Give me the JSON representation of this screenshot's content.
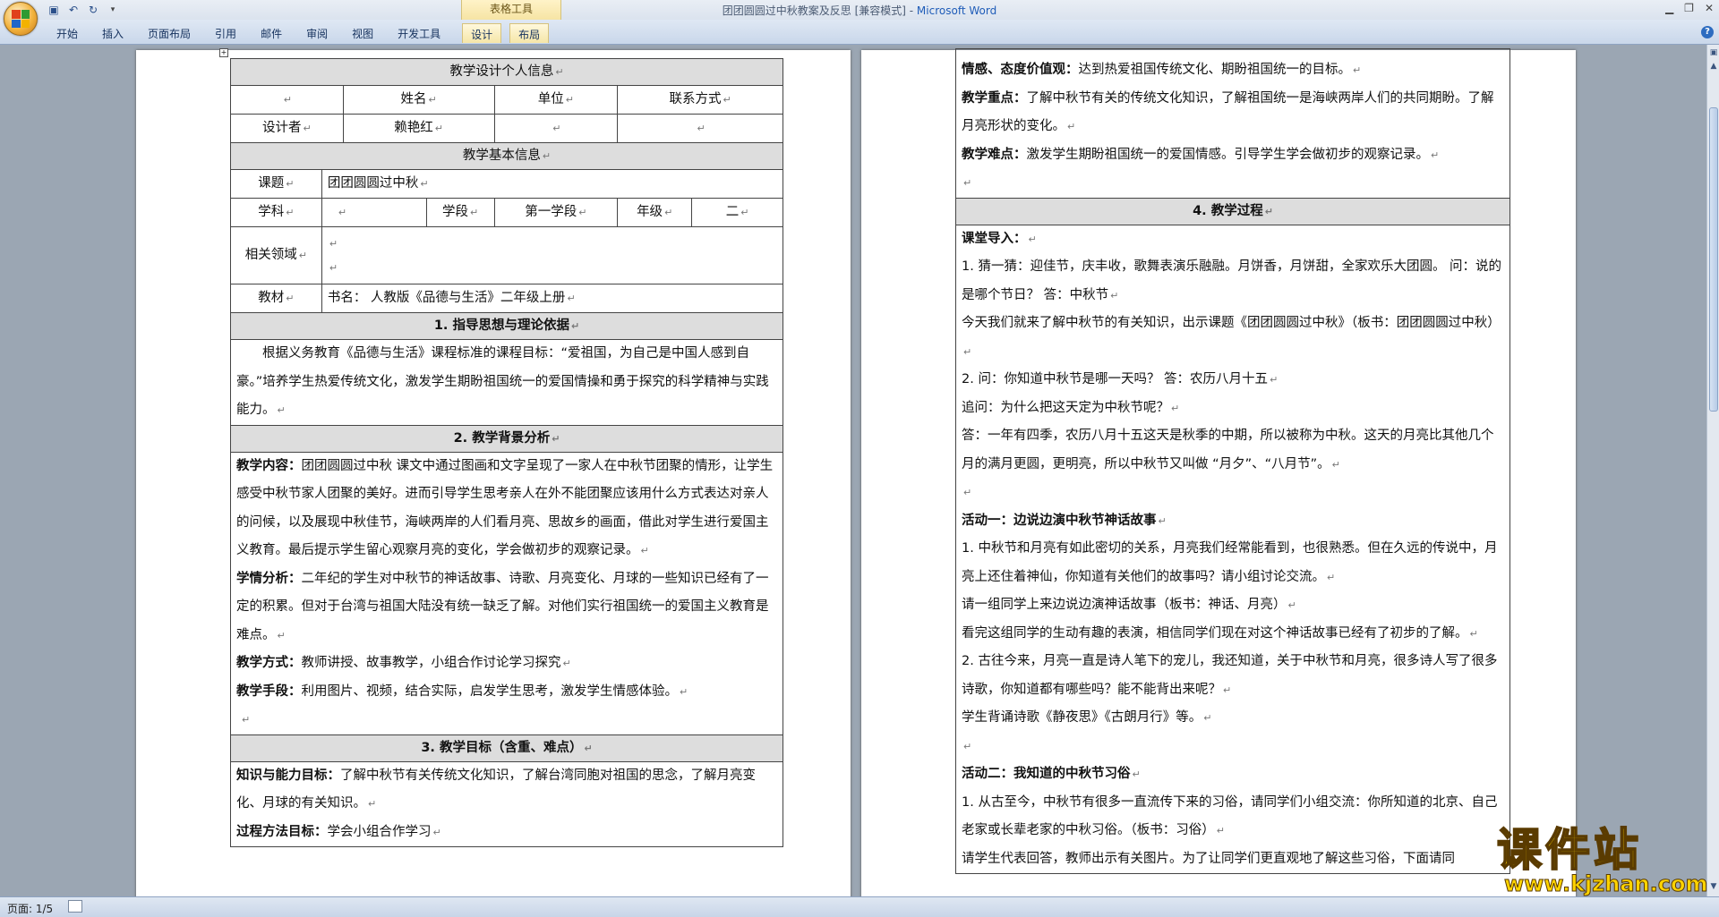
{
  "window": {
    "title": "团团圆圆过中秋教案及反思 [兼容模式] - ",
    "app_name": "Microsoft Word",
    "context_tab_group": "表格工具"
  },
  "ribbon": {
    "tabs": [
      "开始",
      "插入",
      "页面布局",
      "引用",
      "邮件",
      "审阅",
      "视图",
      "开发工具",
      "设计",
      "布局"
    ]
  },
  "left_page": {
    "personal_info_header": "教学设计个人信息",
    "col_name": "姓名",
    "col_unit": "单位",
    "col_contact": "联系方式",
    "designer_label": "设计者",
    "designer_name": "赖艳红",
    "basic_info_header": "教学基本信息",
    "topic_label": "课题",
    "topic_value": "团团圆圆过中秋",
    "subject_label": "学科",
    "stage_label": "学段",
    "stage_value": "第一学段",
    "grade_label": "年级",
    "grade_value": "二",
    "field_label": "相关领域",
    "textbook_label": "教材",
    "textbook_value": "书名：   人教版《品德与生活》二年级上册",
    "sec1": "1. 指导思想与理论依据",
    "sec1_text": "根据义务教育《品德与生活》课程标准的课程目标：“爱祖国，为自己是中国人感到自豪。”培养学生热爱传统文化，激发学生期盼祖国统一的爱国情操和勇于探究的科学精神与实践能力。",
    "sec2": "2. 教学背景分析",
    "content_label": "教学内容：",
    "content_text": "团团圆圆过中秋 课文中通过图画和文字呈现了一家人在中秋节团聚的情形，让学生感受中秋节家人团聚的美好。进而引导学生思考亲人在外不能团聚应该用什么方式表达对亲人的问候，以及展现中秋佳节，海峡两岸的人们看月亮、思故乡的画面，借此对学生进行爱国主义教育。最后提示学生留心观察月亮的变化，学会做初步的观察记录。",
    "learner_label": "学情分析：",
    "learner_text": "二年纪的学生对中秋节的神话故事、诗歌、月亮变化、月球的一些知识已经有了一定的积累。但对于台湾与祖国大陆没有统一缺乏了解。对他们实行祖国统一的爱国主义教育是难点。",
    "method_label": "教学方式：",
    "method_text": "教师讲授、故事教学，小组合作讨论学习探究",
    "means_label": "教学手段：",
    "means_text": "利用图片、视频，结合实际，启发学生思考，激发学生情感体验。",
    "sec3": "3. 教学目标（含重、难点）",
    "knowledge_label": "知识与能力目标：",
    "knowledge_text": "了解中秋节有关传统文化知识，了解台湾同胞对祖国的思念，了解月亮变化、月球的有关知识。",
    "process_label": "过程方法目标：",
    "process_text": "学会小组合作学习"
  },
  "right_page": {
    "emotion_label": "情感、态度价值观：",
    "emotion_text": "达到热爱祖国传统文化、期盼祖国统一的目标。",
    "key_label": "教学重点：",
    "key_text": "了解中秋节有关的传统文化知识，了解祖国统一是海峡两岸人们的共同期盼。了解月亮形状的变化。",
    "difficult_label": "教学难点：",
    "difficult_text": "激发学生期盼祖国统一的爱国情感。引导学生学会做初步的观察记录。",
    "sec4": "4. 教学过程",
    "intro_label": "课堂导入：",
    "p1": "1. 猜一猜：迎佳节，庆丰收，歌舞表演乐融融。月饼香，月饼甜，全家欢乐大团圆。  问：说的是哪个节日？  答：中秋节",
    "p2": "今天我们就来了解中秋节的有关知识，出示课题《团团圆圆过中秋》（板书：团团圆圆过中秋）",
    "p3": "2. 问：你知道中秋节是哪一天吗？    答：农历八月十五",
    "p4": "追问：为什么把这天定为中秋节呢？",
    "p5": "答：一年有四季，农历八月十五这天是秋季的中期，所以被称为中秋。这天的月亮比其他几个月的满月更圆，更明亮，所以中秋节又叫做 “月夕”、“八月节”。",
    "act1_label": "活动一：边说边演中秋节神话故事",
    "a1": "1. 中秋节和月亮有如此密切的关系，月亮我们经常能看到，也很熟悉。但在久远的传说中，月亮上还住着神仙，你知道有关他们的故事吗？请小组讨论交流。",
    "a2": "请一组同学上来边说边演神话故事（板书：神话、月亮）",
    "a3": "看完这组同学的生动有趣的表演，相信同学们现在对这个神话故事已经有了初步的了解。",
    "a4": "2. 古往今来，月亮一直是诗人笔下的宠儿，我还知道，关于中秋节和月亮，很多诗人写了很多诗歌，你知道都有哪些吗？能不能背出来呢？",
    "a5": "学生背诵诗歌《静夜思》《古朗月行》等。",
    "act2_label": "活动二：我知道的中秋节习俗",
    "b1": "1. 从古至今，中秋节有很多一直流传下来的习俗，请同学们小组交流：你所知道的北京、自己老家或长辈老家的中秋习俗。（板书：习俗）",
    "b2": "请学生代表回答，教师出示有关图片。为了让同学们更直观地了解这些习俗，下面请同"
  },
  "status": {
    "page_info": "页面: 1/5"
  },
  "watermark": {
    "title": "课件站",
    "url": "www.kjzhan.com"
  }
}
